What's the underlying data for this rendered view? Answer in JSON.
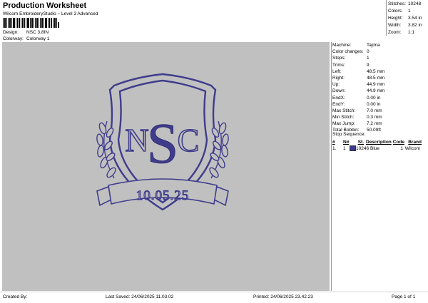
{
  "header": {
    "title": "Production Worksheet",
    "subtitle": "Wilcom EmbroideryStudio – Level 3 Advanced",
    "design_label": "Design:",
    "design_value": "NSC 3,8IN",
    "colorway_label": "Colorway:",
    "colorway_value": "Colorway 1"
  },
  "summary": [
    {
      "label": "Stitches:",
      "value": "10248"
    },
    {
      "label": "Colors:",
      "value": "1"
    },
    {
      "label": "Height:",
      "value": "3.54 in"
    },
    {
      "label": "Width:",
      "value": "3.82 in"
    },
    {
      "label": "Zoom:",
      "value": "1:1"
    }
  ],
  "machine_info": [
    {
      "label": "Machine:",
      "value": "Tajima"
    },
    {
      "label": "Color changes:",
      "value": "0"
    },
    {
      "label": "Stops:",
      "value": "1"
    },
    {
      "label": "Trims:",
      "value": "9"
    },
    {
      "label": "Left:",
      "value": "48.5 mm"
    },
    {
      "label": "Right:",
      "value": "48.5 mm"
    },
    {
      "label": "Up:",
      "value": "44.9 mm"
    },
    {
      "label": "Down:",
      "value": "44.9 mm"
    },
    {
      "label": "EndX:",
      "value": "0.00 in"
    },
    {
      "label": "EndY:",
      "value": "0.00 in"
    },
    {
      "label": "Max Stitch:",
      "value": "7.0 mm"
    },
    {
      "label": "Min Stitch:",
      "value": "0.3 mm"
    },
    {
      "label": "Max Jump:",
      "value": "7.2 mm"
    },
    {
      "label": "Total Bobbin:",
      "value": "50.09ft"
    }
  ],
  "stop_sequence": {
    "heading": "Stop Sequence:",
    "columns": [
      "#",
      "N#",
      "St.",
      "Description",
      "Code",
      "Brand"
    ],
    "rows": [
      {
        "num": "1.",
        "n": "1",
        "st": "10246",
        "description": "Blue",
        "code": "1",
        "brand": "Wilcom",
        "color": "#3b3a8a"
      }
    ]
  },
  "design": {
    "monogram_left": "N",
    "monogram_center": "S",
    "monogram_right": "C",
    "banner_text": "10.05.25",
    "thread_color": "#3f3c8c",
    "background_color": "#c0c0c0"
  },
  "footer": {
    "created_by": "Created By:",
    "last_saved": "Last Saved: 24/06/2025 11.03.02",
    "printed": "Printed: 24/06/2025 23.42.23",
    "page": "Page 1 of 1"
  }
}
